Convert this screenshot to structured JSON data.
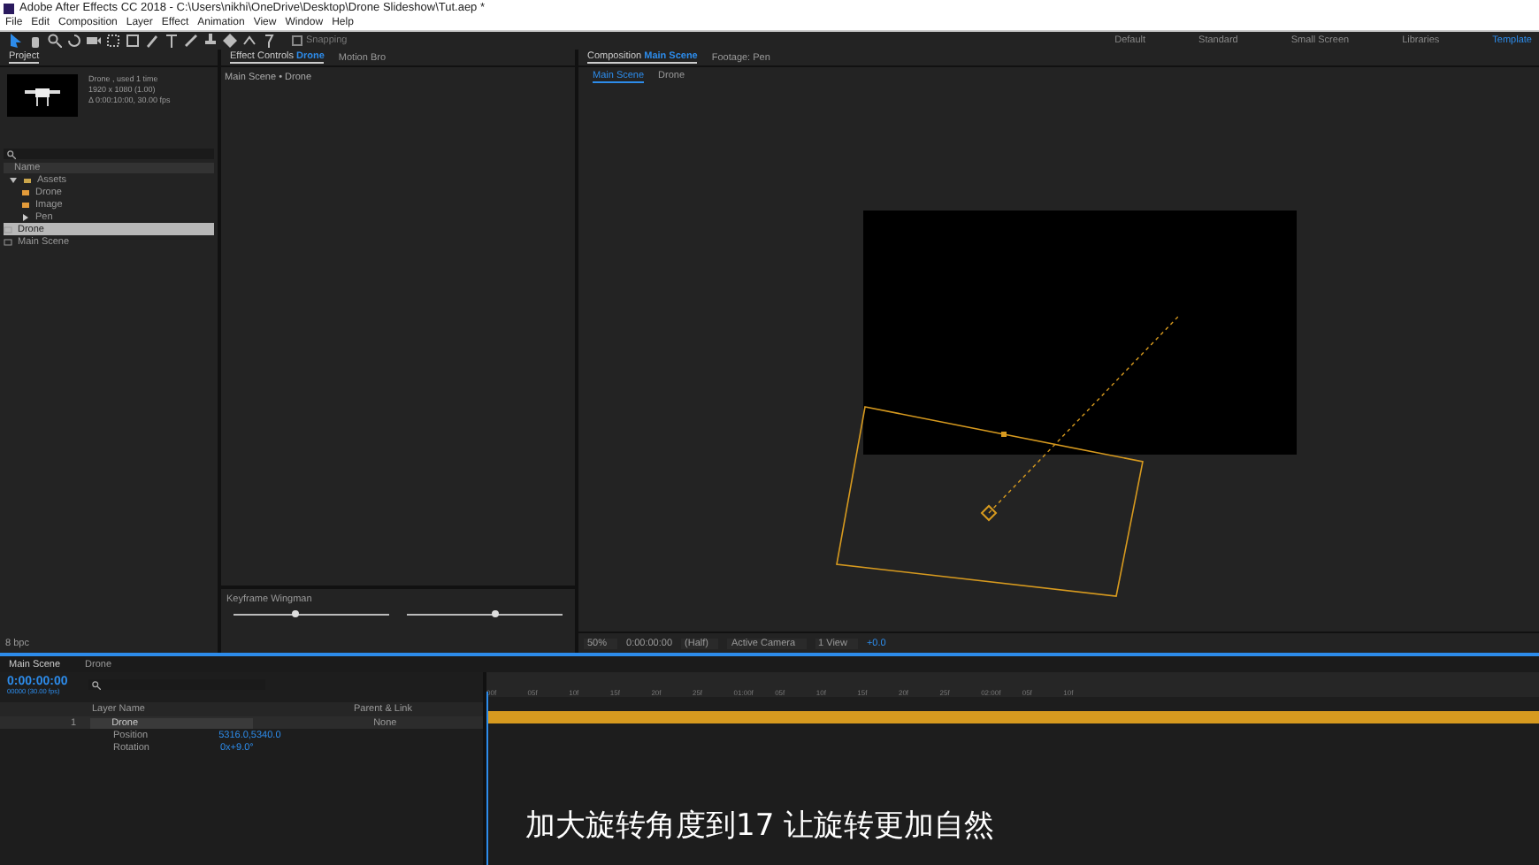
{
  "window": {
    "title": "Adobe After Effects CC 2018 - C:\\Users\\nikhi\\OneDrive\\Desktop\\Drone Slideshow\\Tut.aep *"
  },
  "menu": [
    "File",
    "Edit",
    "Composition",
    "Layer",
    "Effect",
    "Animation",
    "View",
    "Window",
    "Help"
  ],
  "toolbar": {
    "snapping": {
      "label": "Snapping",
      "checked": false
    }
  },
  "workspaces": [
    {
      "label": "Default",
      "selected": false
    },
    {
      "label": "Standard",
      "selected": false
    },
    {
      "label": "Small Screen",
      "selected": false
    },
    {
      "label": "Libraries",
      "selected": false
    },
    {
      "label": "Template",
      "selected": true
    }
  ],
  "project": {
    "title": "Project",
    "preview": {
      "name": "Drone",
      "usage": ", used 1 time",
      "size": "1920 x 1080 (1.00)",
      "duration": "Δ 0:00:10:00, 30.00 fps"
    },
    "column": "Name",
    "items": [
      {
        "name": "Assets",
        "kind": "folder",
        "selected": false,
        "expanded": true,
        "children": [
          {
            "name": "Drone",
            "kind": "image",
            "selected": false
          },
          {
            "name": "Image",
            "kind": "image",
            "selected": false
          },
          {
            "name": "Pen",
            "kind": "footage",
            "selected": false
          }
        ]
      },
      {
        "name": "Drone",
        "kind": "comp",
        "selected": true
      },
      {
        "name": "Main Scene",
        "kind": "comp",
        "selected": false
      }
    ],
    "bpc": "8 bpc"
  },
  "effect_controls": {
    "tabs": [
      {
        "label": "Effect Controls",
        "target": "Drone",
        "selected": true
      },
      {
        "label": "Motion Bro",
        "selected": false
      }
    ],
    "subtitle": "Main Scene • Drone"
  },
  "keyframe_wingman": {
    "title": "Keyframe Wingman",
    "sliders": [
      {
        "level": 0.4
      },
      {
        "level": 0.57
      }
    ]
  },
  "composition": {
    "tabs": [
      {
        "label": "Composition",
        "target": "Main Scene",
        "selected": true
      },
      {
        "label": "Footage: Pen",
        "selected": false
      }
    ],
    "breadcrumbs": [
      {
        "label": "Main Scene",
        "selected": true
      },
      {
        "label": "Drone",
        "selected": false
      }
    ],
    "toolbar": {
      "zoom": "50%",
      "time": "0:00:00:00",
      "resolution": "(Half)",
      "camera": "Active Camera",
      "view": "1 View",
      "exposure": "+0.0"
    }
  },
  "timeline": {
    "tabs": [
      {
        "label": "Main Scene",
        "selected": true
      },
      {
        "label": "Drone",
        "selected": false
      }
    ],
    "time": "0:00:00:00",
    "frame": "00000 (30.00 fps)",
    "columns": {
      "layer_name": "Layer Name",
      "parent": "Parent & Link"
    },
    "layers": [
      {
        "index": "1",
        "name": "Drone",
        "parent": "None",
        "properties": [
          {
            "name": "Position",
            "value": "5316.0,5340.0"
          },
          {
            "name": "Rotation",
            "value": "0x+9.0°"
          }
        ]
      }
    ],
    "ruler": [
      "00f",
      "05f",
      "10f",
      "15f",
      "20f",
      "25f",
      "01:00f",
      "05f",
      "10f",
      "15f",
      "20f",
      "25f",
      "02:00f",
      "05f",
      "10f"
    ]
  },
  "subtitle": "加大旋转角度到17 让旋转更加自然"
}
